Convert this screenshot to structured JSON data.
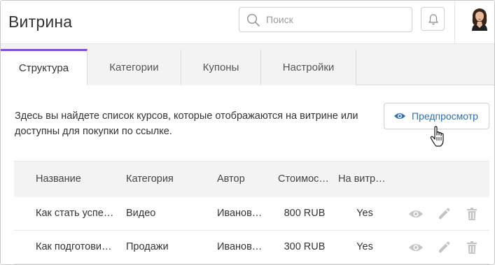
{
  "header": {
    "title": "Витрина",
    "search_placeholder": "Поиск",
    "icons": [
      "search-icon",
      "bell-icon",
      "avatar"
    ]
  },
  "tabs": [
    {
      "label": "Структура",
      "active": true
    },
    {
      "label": "Категории",
      "active": false
    },
    {
      "label": "Купоны",
      "active": false
    },
    {
      "label": "Настройки",
      "active": false
    }
  ],
  "main": {
    "description": "Здесь вы найдете список курсов, которые отображаются на витрине или доступны для покупки по ссылке.",
    "preview_button": "Предпросмотр"
  },
  "table": {
    "columns": [
      "Название",
      "Категория",
      "Автор",
      "Стоимос…",
      "На витр…"
    ],
    "rows": [
      {
        "name": "Как стать успе…",
        "category": "Видео",
        "author": "Иванов…",
        "price": "800 RUB",
        "on_showcase": "Yes"
      },
      {
        "name": "Как подготови…",
        "category": "Продажи",
        "author": "Иванов…",
        "price": "300 RUB",
        "on_showcase": "Yes"
      }
    ],
    "row_actions": [
      "eye-icon",
      "pencil-icon",
      "trash-icon"
    ]
  },
  "colors": {
    "accent": "#7b4fd6",
    "link": "#2b6fb6",
    "icon_gray": "#c4c4c4"
  }
}
